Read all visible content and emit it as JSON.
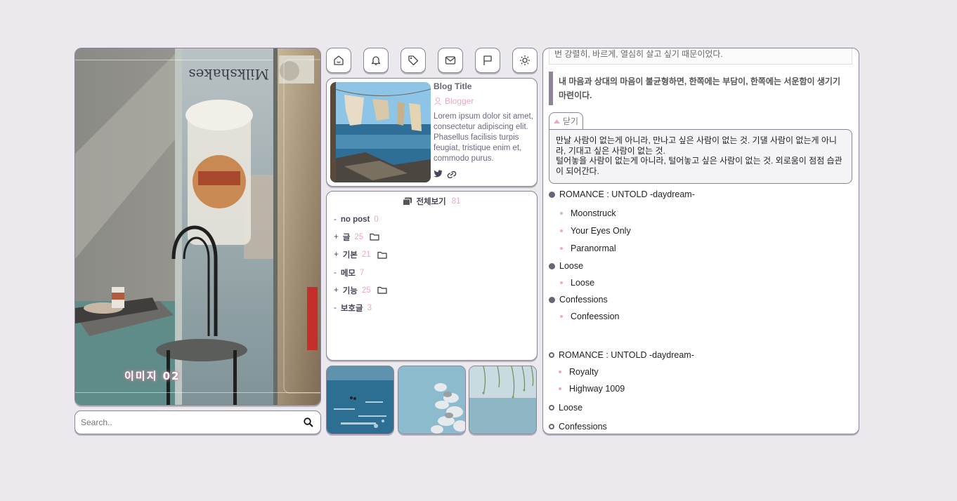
{
  "photo": {
    "caption": "이미지 02",
    "sign_text": "Milkshakes"
  },
  "search": {
    "placeholder": "Search.."
  },
  "toolbar": {
    "icons": [
      "home-icon",
      "bell-icon",
      "tag-icon",
      "mail-icon",
      "flag-icon",
      "sun-icon"
    ]
  },
  "profile": {
    "blog_title": "Blog Title",
    "blogger": "Blogger",
    "description": "Lorem ipsum dolor sit amet, consectetur adipiscing elit. Phasellus facilisis turpis feugiat, tristique enim et, commodo purus."
  },
  "category": {
    "header": "전체보기",
    "total": "81",
    "items": [
      {
        "prefix": "-",
        "label": "no post",
        "count": "0",
        "folder": false
      },
      {
        "prefix": "+",
        "label": "글",
        "count": "25",
        "folder": true
      },
      {
        "prefix": "+",
        "label": "기본",
        "count": "21",
        "folder": true
      },
      {
        "prefix": "-",
        "label": "메모",
        "count": "7",
        "folder": false
      },
      {
        "prefix": "+",
        "label": "기능",
        "count": "25",
        "folder": true
      },
      {
        "prefix": "-",
        "label": "보호글",
        "count": "3",
        "folder": false
      }
    ]
  },
  "article": {
    "top_line": "번 강렬히, 바르게, 열심히 살고 싶기 때문이었다.",
    "blockquote": "내 마음과 상대의 마음이 불균형하면, 한쪽에는 부담이, 한쪽에는 서운함이 생기기 마련이다.",
    "close_label": "닫기",
    "fold_line1": "만날 사람이 없는게 아니라, 만나고 싶은 사람이 없는 것. 기댈 사람이 없는게 아니라, 기대고 싶은 사람이 없는 것.",
    "fold_line2": "털어놓을 사람이 없는게 아니라, 털어놓고 싶은 사람이 없는 것. 외로움이 점점 습관이 되어간다.",
    "list_a": [
      {
        "title": "ROMANCE : UNTOLD -daydream-",
        "children": [
          "Moonstruck",
          "Your Eyes Only",
          "Paranormal"
        ]
      },
      {
        "title": "Loose",
        "children": [
          "Loose"
        ]
      },
      {
        "title": "Confessions",
        "children": [
          "Confeession"
        ]
      }
    ],
    "list_b": [
      {
        "title": "ROMANCE : UNTOLD -daydream-",
        "children": [
          "Royalty",
          "Highway 1009"
        ]
      },
      {
        "title": "Loose",
        "children": []
      },
      {
        "title": "Confessions",
        "children": []
      }
    ]
  }
}
